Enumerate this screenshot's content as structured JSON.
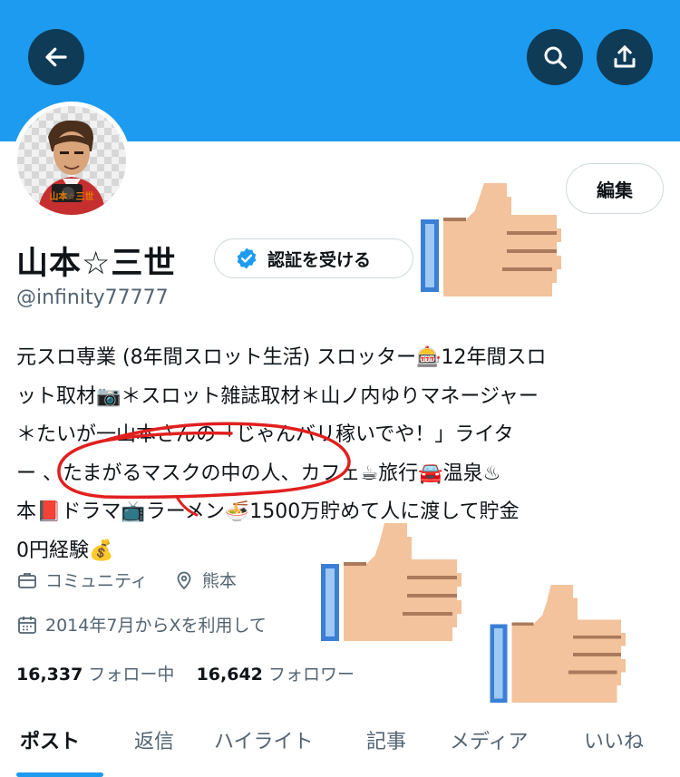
{
  "header": {
    "back_icon": "arrow-left-icon",
    "search_icon": "search-icon",
    "share_icon": "share-icon",
    "banner_color": "#1d9bf0",
    "button_color": "#0f3b57"
  },
  "profile": {
    "avatar_caption": "山本☆三世",
    "edit_label": "編集",
    "display_name": "山本☆三世",
    "verify_label": "認証を受ける",
    "handle": "@infinity77777",
    "bio_lines": [
      "元スロ専業 (8年間スロット生活) スロッター🎰12年間スロ",
      "ット取材📷＊スロット雑誌取材＊山ノ内ゆりマネージャー",
      "＊たいが一山本さんの「じゃんバリ稼いでや！」ライタ",
      "ー 、たまがるマスクの中の人、カフェ☕旅行🚘温泉♨",
      "本📕ドラマ📺ラーメン🍜1500万貯めて人に渡して貯金",
      "0円経験💰"
    ],
    "category": "コミュニティ",
    "location": "熊本",
    "joined": "2014年7月からXを利用して",
    "following_count": "16,337",
    "following_label": "フォロー中",
    "followers_count": "16,642",
    "followers_label": "フォロワー"
  },
  "tabs": [
    {
      "label": "ポスト",
      "active": true
    },
    {
      "label": "返信",
      "active": false
    },
    {
      "label": "ハイライト",
      "active": false
    },
    {
      "label": "記事",
      "active": false
    },
    {
      "label": "メディア",
      "active": false
    },
    {
      "label": "いいね",
      "active": false
    }
  ],
  "accent_color": "#1d9bf0",
  "annotation_color": "#e0201f"
}
